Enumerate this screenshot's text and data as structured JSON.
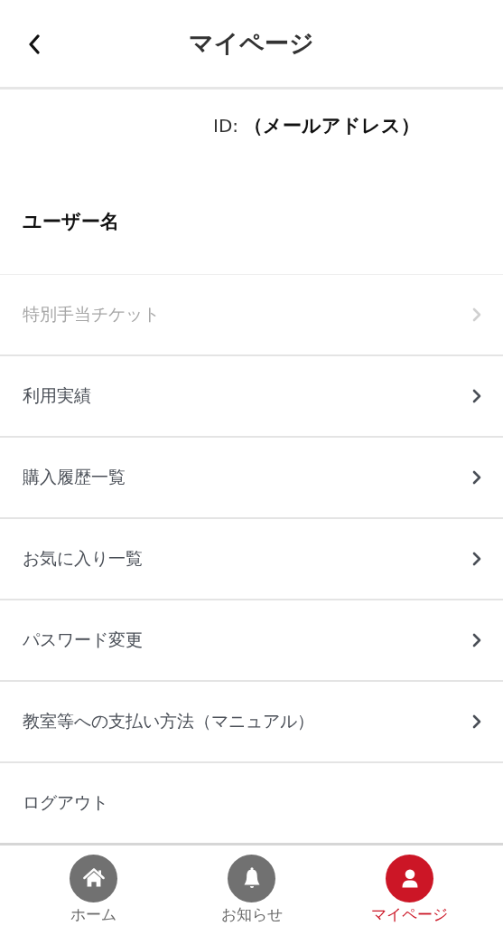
{
  "header": {
    "title": "マイページ"
  },
  "profile": {
    "id_label": "ID:",
    "id_value": "（メールアドレス）",
    "user_name": "ユーザー名"
  },
  "menu": [
    {
      "label": "特別手当チケット",
      "kind": "link",
      "disabled": true
    },
    {
      "label": "利用実績",
      "kind": "link",
      "disabled": false
    },
    {
      "label": "購入履歴一覧",
      "kind": "link",
      "disabled": false
    },
    {
      "label": "お気に入り一覧",
      "kind": "link",
      "disabled": false
    },
    {
      "label": "パスワード変更",
      "kind": "link",
      "disabled": false
    },
    {
      "label": "教室等への支払い方法（マニュアル）",
      "kind": "link",
      "disabled": false
    },
    {
      "label": "ログアウト",
      "kind": "action",
      "disabled": false
    }
  ],
  "tabs": [
    {
      "label": "ホーム",
      "kind": "home",
      "selected": false
    },
    {
      "label": "お知らせ",
      "kind": "bell",
      "selected": false
    },
    {
      "label": "マイページ",
      "kind": "person",
      "selected": true
    }
  ]
}
